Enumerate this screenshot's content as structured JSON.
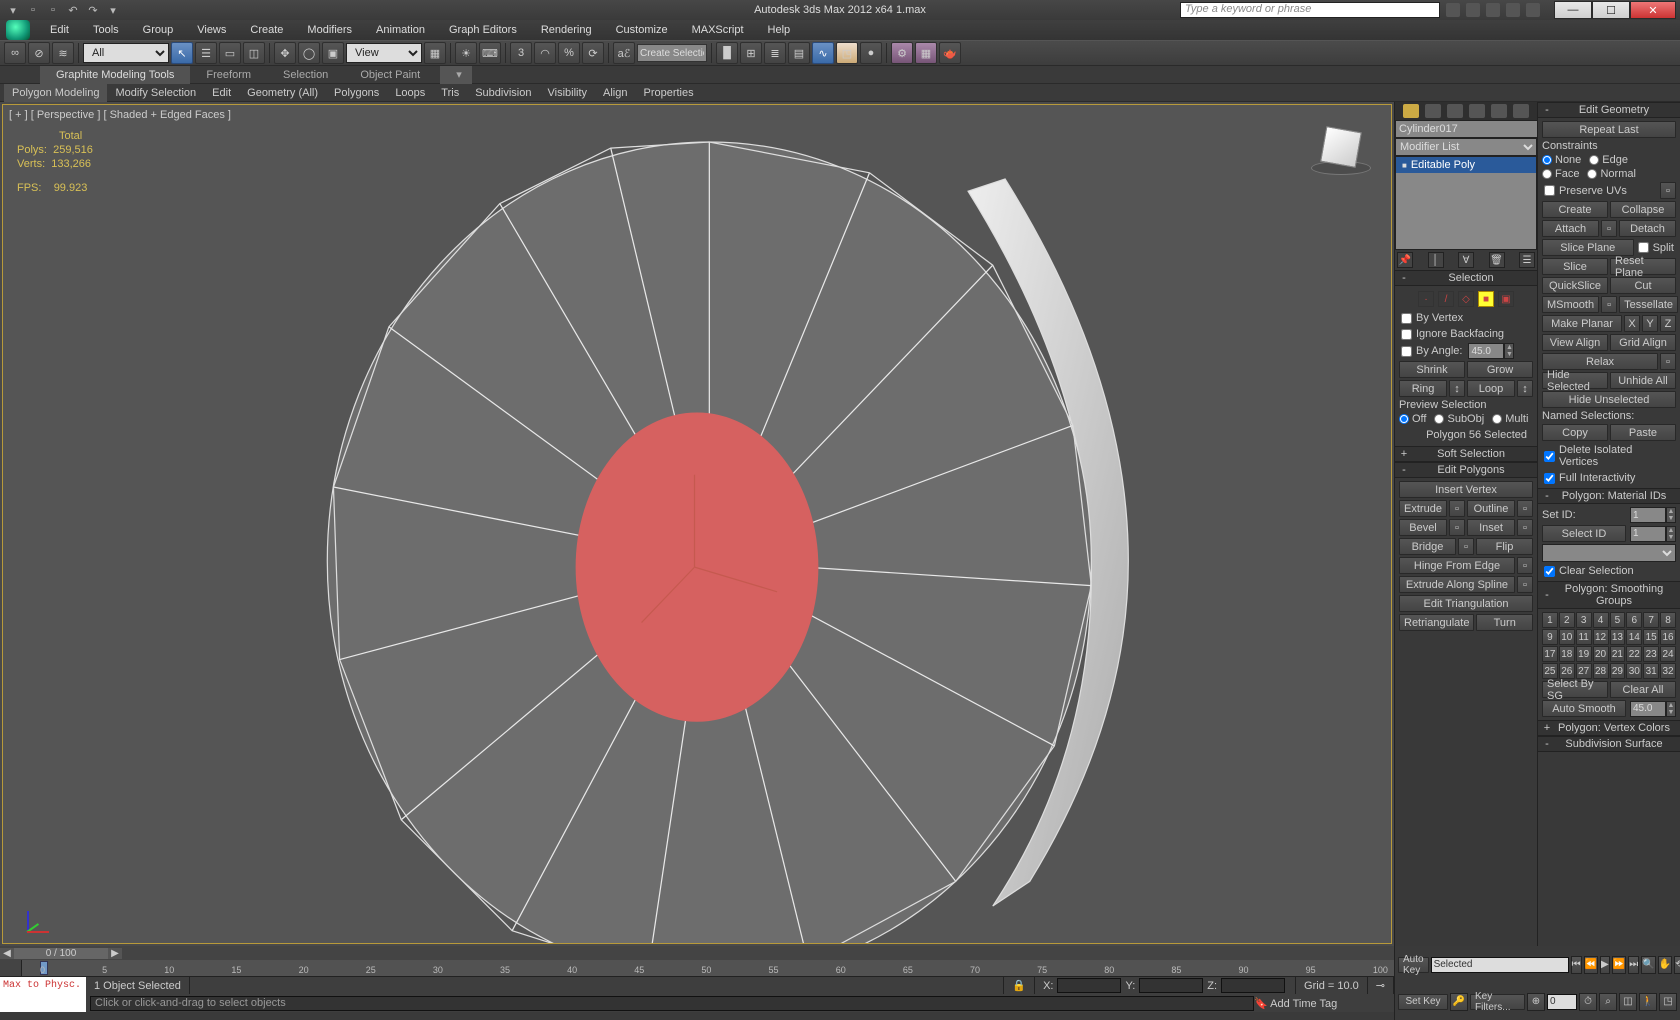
{
  "title": "Autodesk 3ds Max 2012 x64     1.max",
  "search_placeholder": "Type a keyword or phrase",
  "menu": [
    "Edit",
    "Tools",
    "Group",
    "Views",
    "Create",
    "Modifiers",
    "Animation",
    "Graph Editors",
    "Rendering",
    "Customize",
    "MAXScript",
    "Help"
  ],
  "toolbar": {
    "all_label": "All",
    "view_label": "View",
    "sel_hint": "Create Selection Se"
  },
  "ribbon_tabs": [
    "Graphite Modeling Tools",
    "Freeform",
    "Selection",
    "Object Paint"
  ],
  "ribbon_sub": [
    "Polygon Modeling",
    "Modify Selection",
    "Edit",
    "Geometry (All)",
    "Polygons",
    "Loops",
    "Tris",
    "Subdivision",
    "Visibility",
    "Align",
    "Properties"
  ],
  "viewport": {
    "label": "[ + ] [ Perspective ] [ Shaded + Edged Faces ]",
    "stats": {
      "total": "Total",
      "polys_label": "Polys:",
      "polys": "259,516",
      "verts_label": "Verts:",
      "verts": "133,266",
      "fps_label": "FPS:",
      "fps": "99.923"
    }
  },
  "cmd": {
    "object": "Cylinder017",
    "modlist": "Modifier List",
    "stack_item": "Editable Poly",
    "selection": {
      "head": "Selection",
      "by_vertex": "By Vertex",
      "ignore_bf": "Ignore Backfacing",
      "by_angle": "By Angle:",
      "angle_val": "45.0",
      "shrink": "Shrink",
      "grow": "Grow",
      "ring": "Ring",
      "loop": "Loop",
      "preview": "Preview Selection",
      "off": "Off",
      "subobj": "SubObj",
      "multi": "Multi",
      "status": "Polygon 56 Selected"
    },
    "softsel": "Soft Selection",
    "editpoly": {
      "head": "Edit Polygons",
      "insert_vertex": "Insert Vertex",
      "extrude": "Extrude",
      "outline": "Outline",
      "bevel": "Bevel",
      "inset": "Inset",
      "bridge": "Bridge",
      "flip": "Flip",
      "hinge": "Hinge From Edge",
      "extr_spline": "Extrude Along Spline",
      "edit_tri": "Edit Triangulation",
      "retri": "Retriangulate",
      "turn": "Turn"
    },
    "editgeom": {
      "head": "Edit Geometry",
      "repeat": "Repeat Last",
      "constraints": "Constraints",
      "none": "None",
      "edge": "Edge",
      "face": "Face",
      "normal": "Normal",
      "preserve_uv": "Preserve UVs",
      "create": "Create",
      "collapse": "Collapse",
      "attach": "Attach",
      "detach": "Detach",
      "slice_plane": "Slice Plane",
      "split": "Split",
      "slice": "Slice",
      "reset_plane": "Reset Plane",
      "quickslice": "QuickSlice",
      "cut": "Cut",
      "msmooth": "MSmooth",
      "tessellate": "Tessellate",
      "make_planar": "Make Planar",
      "x": "X",
      "y": "Y",
      "z": "Z",
      "view_align": "View Align",
      "grid_align": "Grid Align",
      "relax": "Relax",
      "hide_sel": "Hide Selected",
      "unhide": "Unhide All",
      "hide_unsel": "Hide Unselected",
      "named": "Named Selections:",
      "copy": "Copy",
      "paste": "Paste",
      "del_iso": "Delete Isolated Vertices",
      "full_int": "Full Interactivity"
    },
    "matids": {
      "head": "Polygon: Material IDs",
      "setid": "Set ID:",
      "setid_v": "1",
      "selid": "Select ID",
      "selid_v": "1",
      "clear": "Clear Selection"
    },
    "sg": {
      "head": "Polygon: Smoothing Groups",
      "selbysg": "Select By SG",
      "clearall": "Clear All",
      "autosm": "Auto Smooth",
      "autosm_v": "45.0"
    },
    "vcolor": "Polygon: Vertex Colors",
    "subdiv": "Subdivision Surface"
  },
  "bottom": {
    "slider": "0 / 100",
    "ticks": [
      "0",
      "5",
      "10",
      "15",
      "20",
      "25",
      "30",
      "35",
      "40",
      "45",
      "50",
      "55",
      "60",
      "65",
      "70",
      "75",
      "80",
      "85",
      "90",
      "95",
      "100"
    ],
    "sel": "1 Object Selected",
    "xyz": {
      "x": "X:",
      "y": "Y:",
      "z": "Z:"
    },
    "grid": "Grid = 10.0",
    "prompt": "Click or click-and-drag to select objects",
    "addtag": "Add Time Tag",
    "script1": "Max to Physc."
  },
  "anim": {
    "autokey": "Auto Key",
    "setkey": "Set Key",
    "selected": "Selected",
    "keyfilters": "Key Filters..."
  }
}
